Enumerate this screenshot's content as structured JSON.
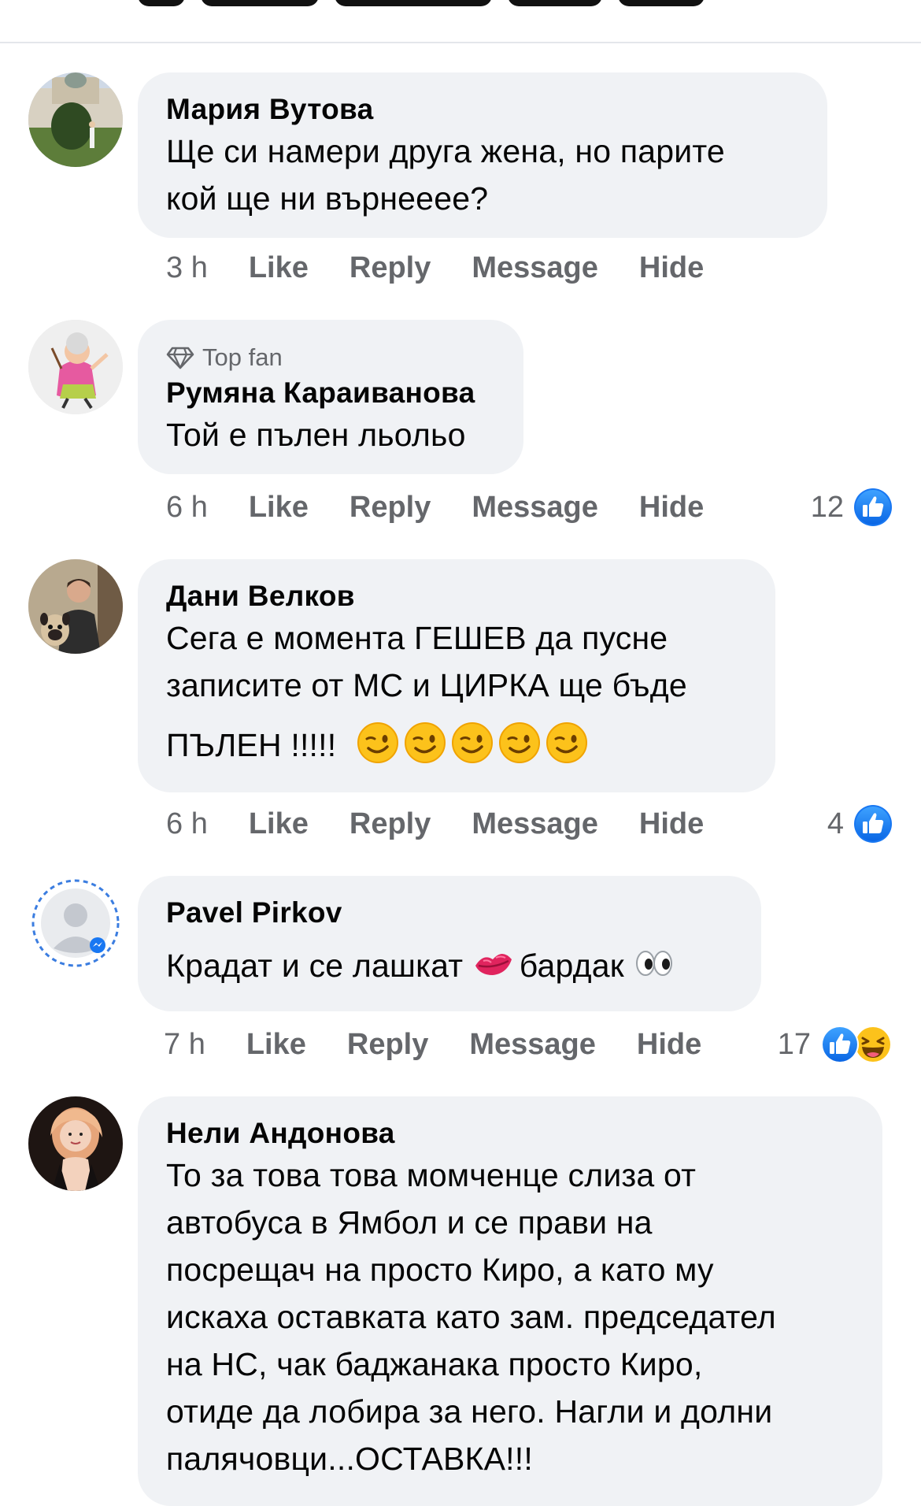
{
  "comments": [
    {
      "author": "Мария Вутова",
      "text_line1": "Ще си намери друга жена, но парите",
      "text_line2": "кой ще ни върнееее?",
      "time": "3 h",
      "avatar_icon": "profile-photo-garden"
    },
    {
      "badge": "Top fan",
      "author": "Румяна Караиванова",
      "text_line1": "Той е пълен льольо",
      "time": "6 h",
      "reaction_count": "12",
      "avatar_icon": "profile-photo-cartoon"
    },
    {
      "author": "Дани Велков",
      "text_line1": "Сега е момента ГЕШЕВ да пусне",
      "text_line2": "записите от МС и ЦИРКА ще бъде",
      "text_line3": "ПЪЛЕН !!!!!",
      "time": "6 h",
      "reaction_count": "4",
      "avatar_icon": "profile-photo-man-with-dog"
    },
    {
      "author": "Pavel Pirkov",
      "text_part1": "Крадат и се лашкат ",
      "text_part2": "бардак ",
      "time": "7 h",
      "reaction_count": "17",
      "avatar_icon": "default-profile-messenger"
    },
    {
      "author": "Нели Андонова",
      "text_line1": "То за това това момченце слиза от",
      "text_line2": "автобуса в Ямбол и се прави на",
      "text_line3": "посрещач на просто Киро, а като му",
      "text_line4": "искаха оставката като зам. председател",
      "text_line5": "на НС, чак баджанака просто Киро,",
      "text_line6": "отиде да лобира за него. Нагли и долни",
      "text_line7": "палячовци...ОСТАВКА!!!",
      "avatar_icon": "profile-photo-woman"
    }
  ],
  "actions": {
    "like": "Like",
    "reply": "Reply",
    "message": "Message",
    "hide": "Hide"
  },
  "colors": {
    "bubble": "#f0f2f5",
    "meta": "#65676b",
    "like_blue": "#1877f2",
    "divider": "#e4e6eb"
  }
}
